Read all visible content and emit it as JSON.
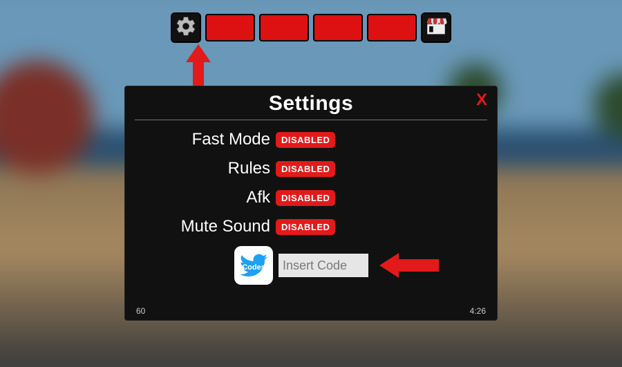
{
  "panel": {
    "title": "Settings",
    "close": "X",
    "footer_left": "60",
    "footer_right": "4:26"
  },
  "settings": [
    {
      "label": "Fast Mode",
      "status": "DISABLED"
    },
    {
      "label": "Rules",
      "status": "DISABLED"
    },
    {
      "label": "Afk",
      "status": "DISABLED"
    },
    {
      "label": "Mute Sound",
      "status": "DISABLED"
    }
  ],
  "codes": {
    "icon_label": "Codes",
    "placeholder": "Insert Code"
  }
}
